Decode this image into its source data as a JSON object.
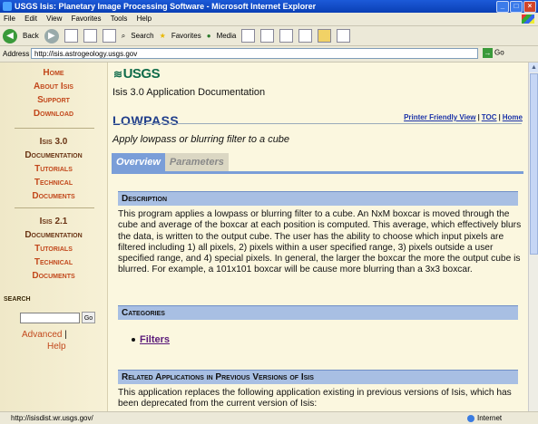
{
  "window": {
    "title": "USGS Isis: Planetary Image Processing Software - Microsoft Internet Explorer",
    "min": "_",
    "max": "□",
    "close": "×"
  },
  "menu": [
    "File",
    "Edit",
    "View",
    "Favorites",
    "Tools",
    "Help"
  ],
  "toolbar": {
    "back": "Back",
    "search": "Search",
    "favorites": "Favorites",
    "media": "Media"
  },
  "address": {
    "label": "Address",
    "url": "http://isis.astrogeology.usgs.gov",
    "go": "Go"
  },
  "sidebar": {
    "main_links": [
      "Home",
      "About Isis",
      "Support",
      "Download"
    ],
    "isis3": {
      "heading": "Isis 3.0",
      "links": [
        "Documentation",
        "Tutorials",
        "Technical",
        "Documents"
      ]
    },
    "isis2": {
      "heading": "Isis 2.1",
      "links": [
        "Documentation",
        "Tutorials",
        "Technical",
        "Documents"
      ]
    },
    "search_label": "SEARCH",
    "search_go": "Go",
    "advanced": "Advanced",
    "help": "Help"
  },
  "main": {
    "logo": "USGS",
    "app_doc": "Isis 3.0 Application Documentation",
    "links": [
      "Printer Friendly View",
      "TOC",
      "Home"
    ],
    "program": "LOWPASS",
    "brief": "Apply lowpass or blurring filter to a cube",
    "tabs": [
      "Overview",
      "Parameters"
    ],
    "description_heading": "Description",
    "description": "This program applies a lowpass or blurring filter to a cube. An NxM boxcar is moved through the cube and average of the boxcar at each position is computed. This average, which effectively blurs the data, is written to the output cube. The user has the ability to choose which input pixels are filtered including 1) all pixels, 2) pixels within a user specified range, 3) pixels outside a user specified range, and 4) special pixels. In general, the larger the boxcar the more the output cube is blurred. For example, a 101x101 boxcar will be cause more blurring than a 3x3 boxcar.",
    "categories_heading": "Categories",
    "category": "Filters",
    "related_heading": "Related Applications in Previous Versions of Isis",
    "related_text": "This application replaces the following application existing in previous versions of Isis, which has been deprecated from the current version of Isis:"
  },
  "status": {
    "url": "http://isisdist.wr.usgs.gov/",
    "zone": "Internet"
  }
}
